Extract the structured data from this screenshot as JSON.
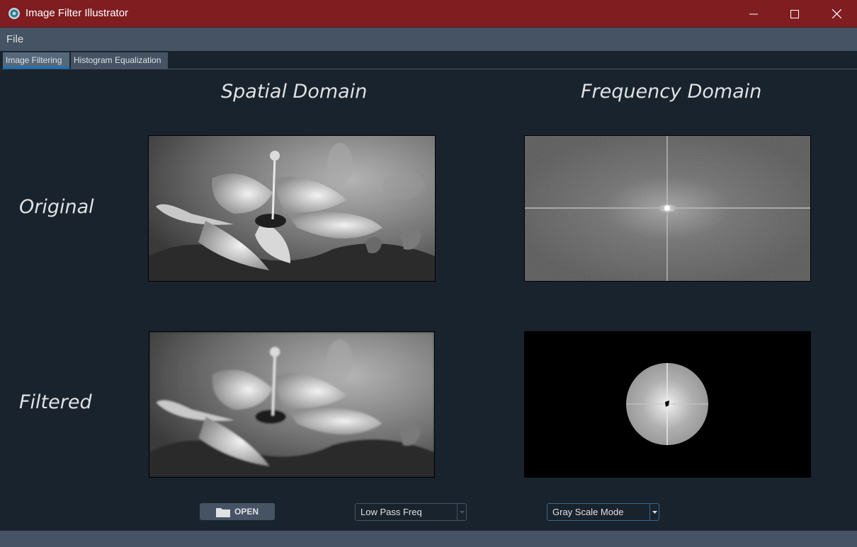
{
  "window": {
    "title": "Image Filter Illustrator",
    "icon": "app-icon",
    "controls": [
      "minimize-icon",
      "maximize-icon",
      "close-icon"
    ]
  },
  "menu": {
    "items": [
      {
        "label": "File"
      }
    ]
  },
  "tabs": [
    {
      "label": "Image Filtering",
      "active": true
    },
    {
      "label": "Histogram Equalization",
      "active": false
    }
  ],
  "headings": {
    "spatial": "Spatial Domain",
    "frequency": "Frequency Domain",
    "original": "Original",
    "filtered": "Filtered"
  },
  "controls": {
    "open_label": "OPEN",
    "filter_select": "Low Pass Freq",
    "mode_select": "Gray Scale Mode"
  },
  "colors": {
    "titlebar": "#7f1d21",
    "background": "#19232d",
    "panel": "#455364",
    "accent": "#1a72bb",
    "text": "#e0e1e3"
  }
}
